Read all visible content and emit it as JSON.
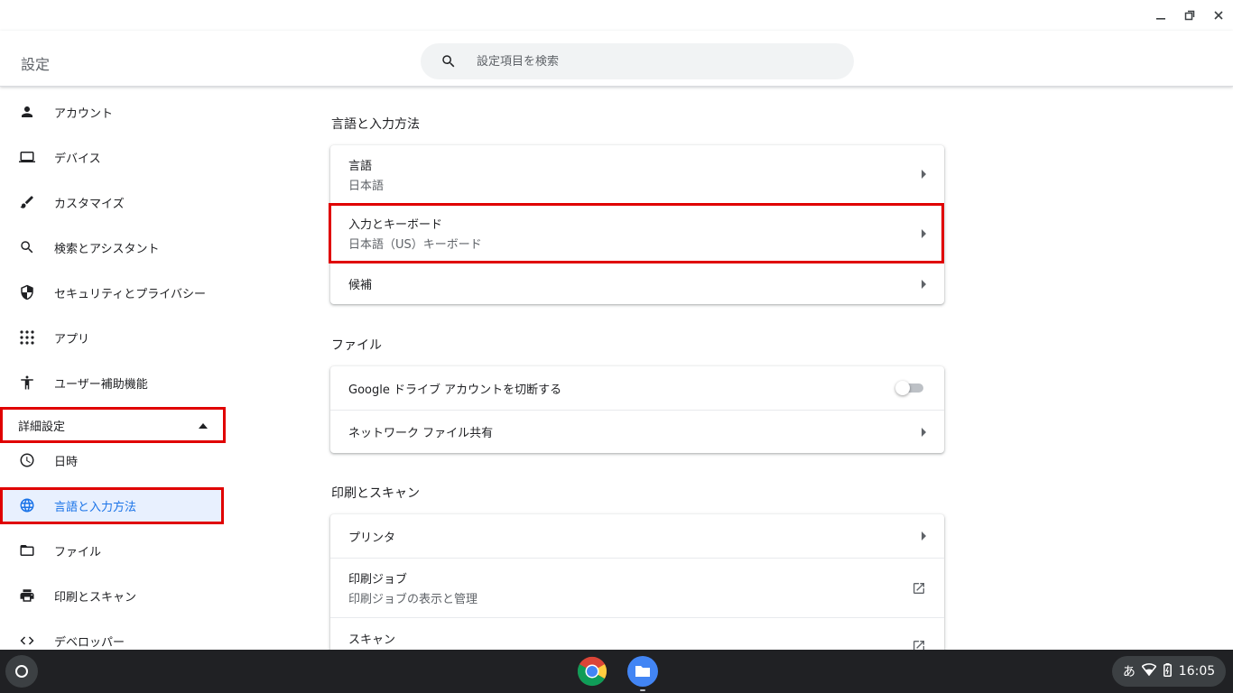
{
  "window": {
    "minimize_icon": "minimize-icon",
    "restore_icon": "restore-icon",
    "close_icon": "close-icon"
  },
  "header": {
    "title": "設定",
    "search_placeholder": "設定項目を検索"
  },
  "sidebar": {
    "items": [
      {
        "label": "アカウント",
        "icon": "person-icon"
      },
      {
        "label": "デバイス",
        "icon": "laptop-icon"
      },
      {
        "label": "カスタマイズ",
        "icon": "brush-icon"
      },
      {
        "label": "検索とアシスタント",
        "icon": "search-icon"
      },
      {
        "label": "セキュリティとプライバシー",
        "icon": "shield-icon"
      },
      {
        "label": "アプリ",
        "icon": "apps-grid-icon"
      },
      {
        "label": "ユーザー補助機能",
        "icon": "accessibility-icon"
      }
    ],
    "advanced_label": "詳細設定",
    "advanced_items": [
      {
        "label": "日時",
        "icon": "clock-icon"
      },
      {
        "label": "言語と入力方法",
        "icon": "globe-icon",
        "active": true
      },
      {
        "label": "ファイル",
        "icon": "folder-icon"
      },
      {
        "label": "印刷とスキャン",
        "icon": "printer-icon"
      },
      {
        "label": "デベロッパー",
        "icon": "code-icon"
      }
    ]
  },
  "sections": [
    {
      "title": "言語と入力方法",
      "rows": [
        {
          "title": "言語",
          "subtitle": "日本語"
        },
        {
          "title": "入力とキーボード",
          "subtitle": "日本語（US）キーボード"
        },
        {
          "title": "候補"
        }
      ]
    },
    {
      "title": "ファイル",
      "rows": [
        {
          "title": "Google ドライブ アカウントを切断する",
          "toggle": false
        },
        {
          "title": "ネットワーク ファイル共有"
        }
      ]
    },
    {
      "title": "印刷とスキャン",
      "rows": [
        {
          "title": "プリンタ"
        },
        {
          "title": "印刷ジョブ",
          "subtitle": "印刷ジョブの表示と管理"
        },
        {
          "title": "スキャン"
        }
      ]
    }
  ],
  "shelf": {
    "ime": "あ",
    "time": "16:05"
  },
  "colors": {
    "accent": "#1a73e8",
    "highlight": "#e00000",
    "active_bg": "#e8f0fe"
  }
}
